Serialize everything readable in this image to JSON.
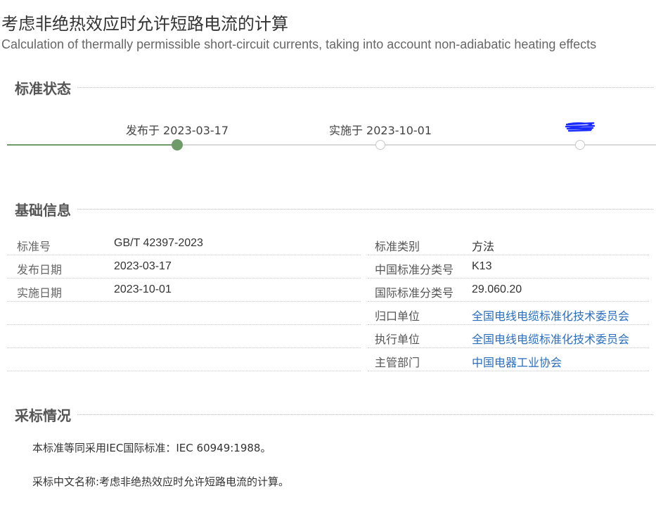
{
  "header": {
    "title_cn": "考虑非绝热效应时允许短路电流的计算",
    "title_en": "Calculation of thermally permissible short-circuit currents, taking into account non-adiabatic heating effects"
  },
  "status_section": {
    "heading": "标准状态",
    "timeline": [
      {
        "label": "发布于 2023-03-17",
        "state": "done"
      },
      {
        "label": "实施于 2023-10-01",
        "state": "pending"
      },
      {
        "label": "",
        "state": "pending",
        "note": "redacted"
      }
    ],
    "colors": {
      "done": "#6f9a6a",
      "pending": "#d8d8d8",
      "redaction": "#1a2cff"
    }
  },
  "basic_section": {
    "heading": "基础信息",
    "left_rows": [
      {
        "key": "标准号",
        "value": "GB/T 42397-2023"
      },
      {
        "key": "发布日期",
        "value": "2023-03-17"
      },
      {
        "key": "实施日期",
        "value": "2023-10-01"
      }
    ],
    "right_rows": [
      {
        "key": "标准类别",
        "value": "方法"
      },
      {
        "key": "中国标准分类号",
        "value": "K13"
      },
      {
        "key": "国际标准分类号",
        "value": "29.060.20"
      },
      {
        "key": "归口单位",
        "value": "全国电线电缆标准化技术委员会"
      },
      {
        "key": "执行单位",
        "value": "全国电线电缆标准化技术委员会"
      },
      {
        "key": "主管部门",
        "value": "中国电器工业协会"
      }
    ],
    "link_color": "#2a6ebd"
  },
  "adoption_section": {
    "heading": "采标情况",
    "line1": "本标准等同采用IEC国际标准：IEC 60949:1988。",
    "line2": "采标中文名称:考虑非绝热效应时允许短路电流的计算。"
  }
}
